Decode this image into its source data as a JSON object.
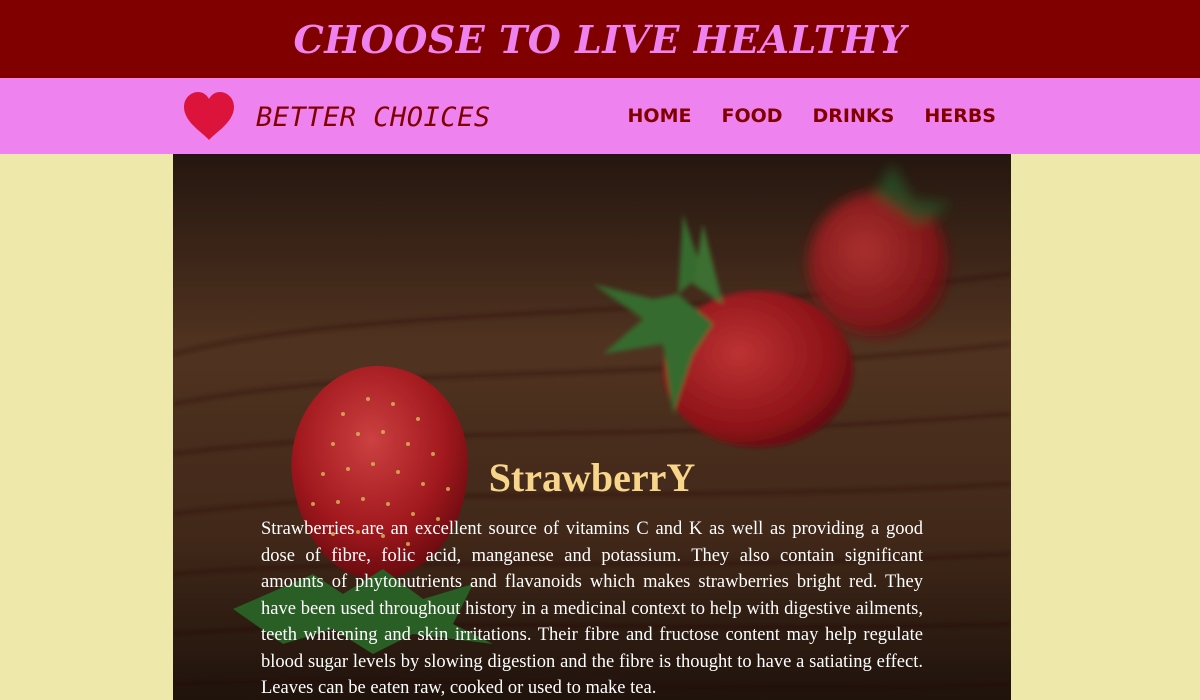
{
  "banner": {
    "title": "CHOOSE TO LIVE HEALTHY"
  },
  "navbar": {
    "brand_icon": "heart-icon",
    "brand_label": "BETTER CHOICES",
    "links": [
      {
        "label": "HOME"
      },
      {
        "label": "FOOD"
      },
      {
        "label": "DRINKS"
      },
      {
        "label": "HERBS"
      }
    ]
  },
  "hero": {
    "image": "strawberries-on-wooden-table",
    "title": "StrawberrY",
    "text": "Strawberries are an excellent source of vitamins C and K as well as providing a good dose of fibre, folic acid, manganese and potassium. They also contain significant amounts of phytonutrients and flavanoids which makes strawberries bright red. They have been used throughout history in a medicinal context to help with digestive ailments, teeth whitening and skin irritations. Their fibre and fructose content may help regulate blood sugar levels by slowing digestion and the fibre is thought to have a satiating effect. Leaves can be eaten raw, cooked or used to make tea."
  },
  "colors": {
    "page_background": "#eee8aa",
    "banner_background": "#800000",
    "banner_text": "#ee82ee",
    "navbar_background": "#ee82ee",
    "nav_text": "#800000",
    "heart": "#dc143c",
    "hero_title": "#f7d58a"
  }
}
